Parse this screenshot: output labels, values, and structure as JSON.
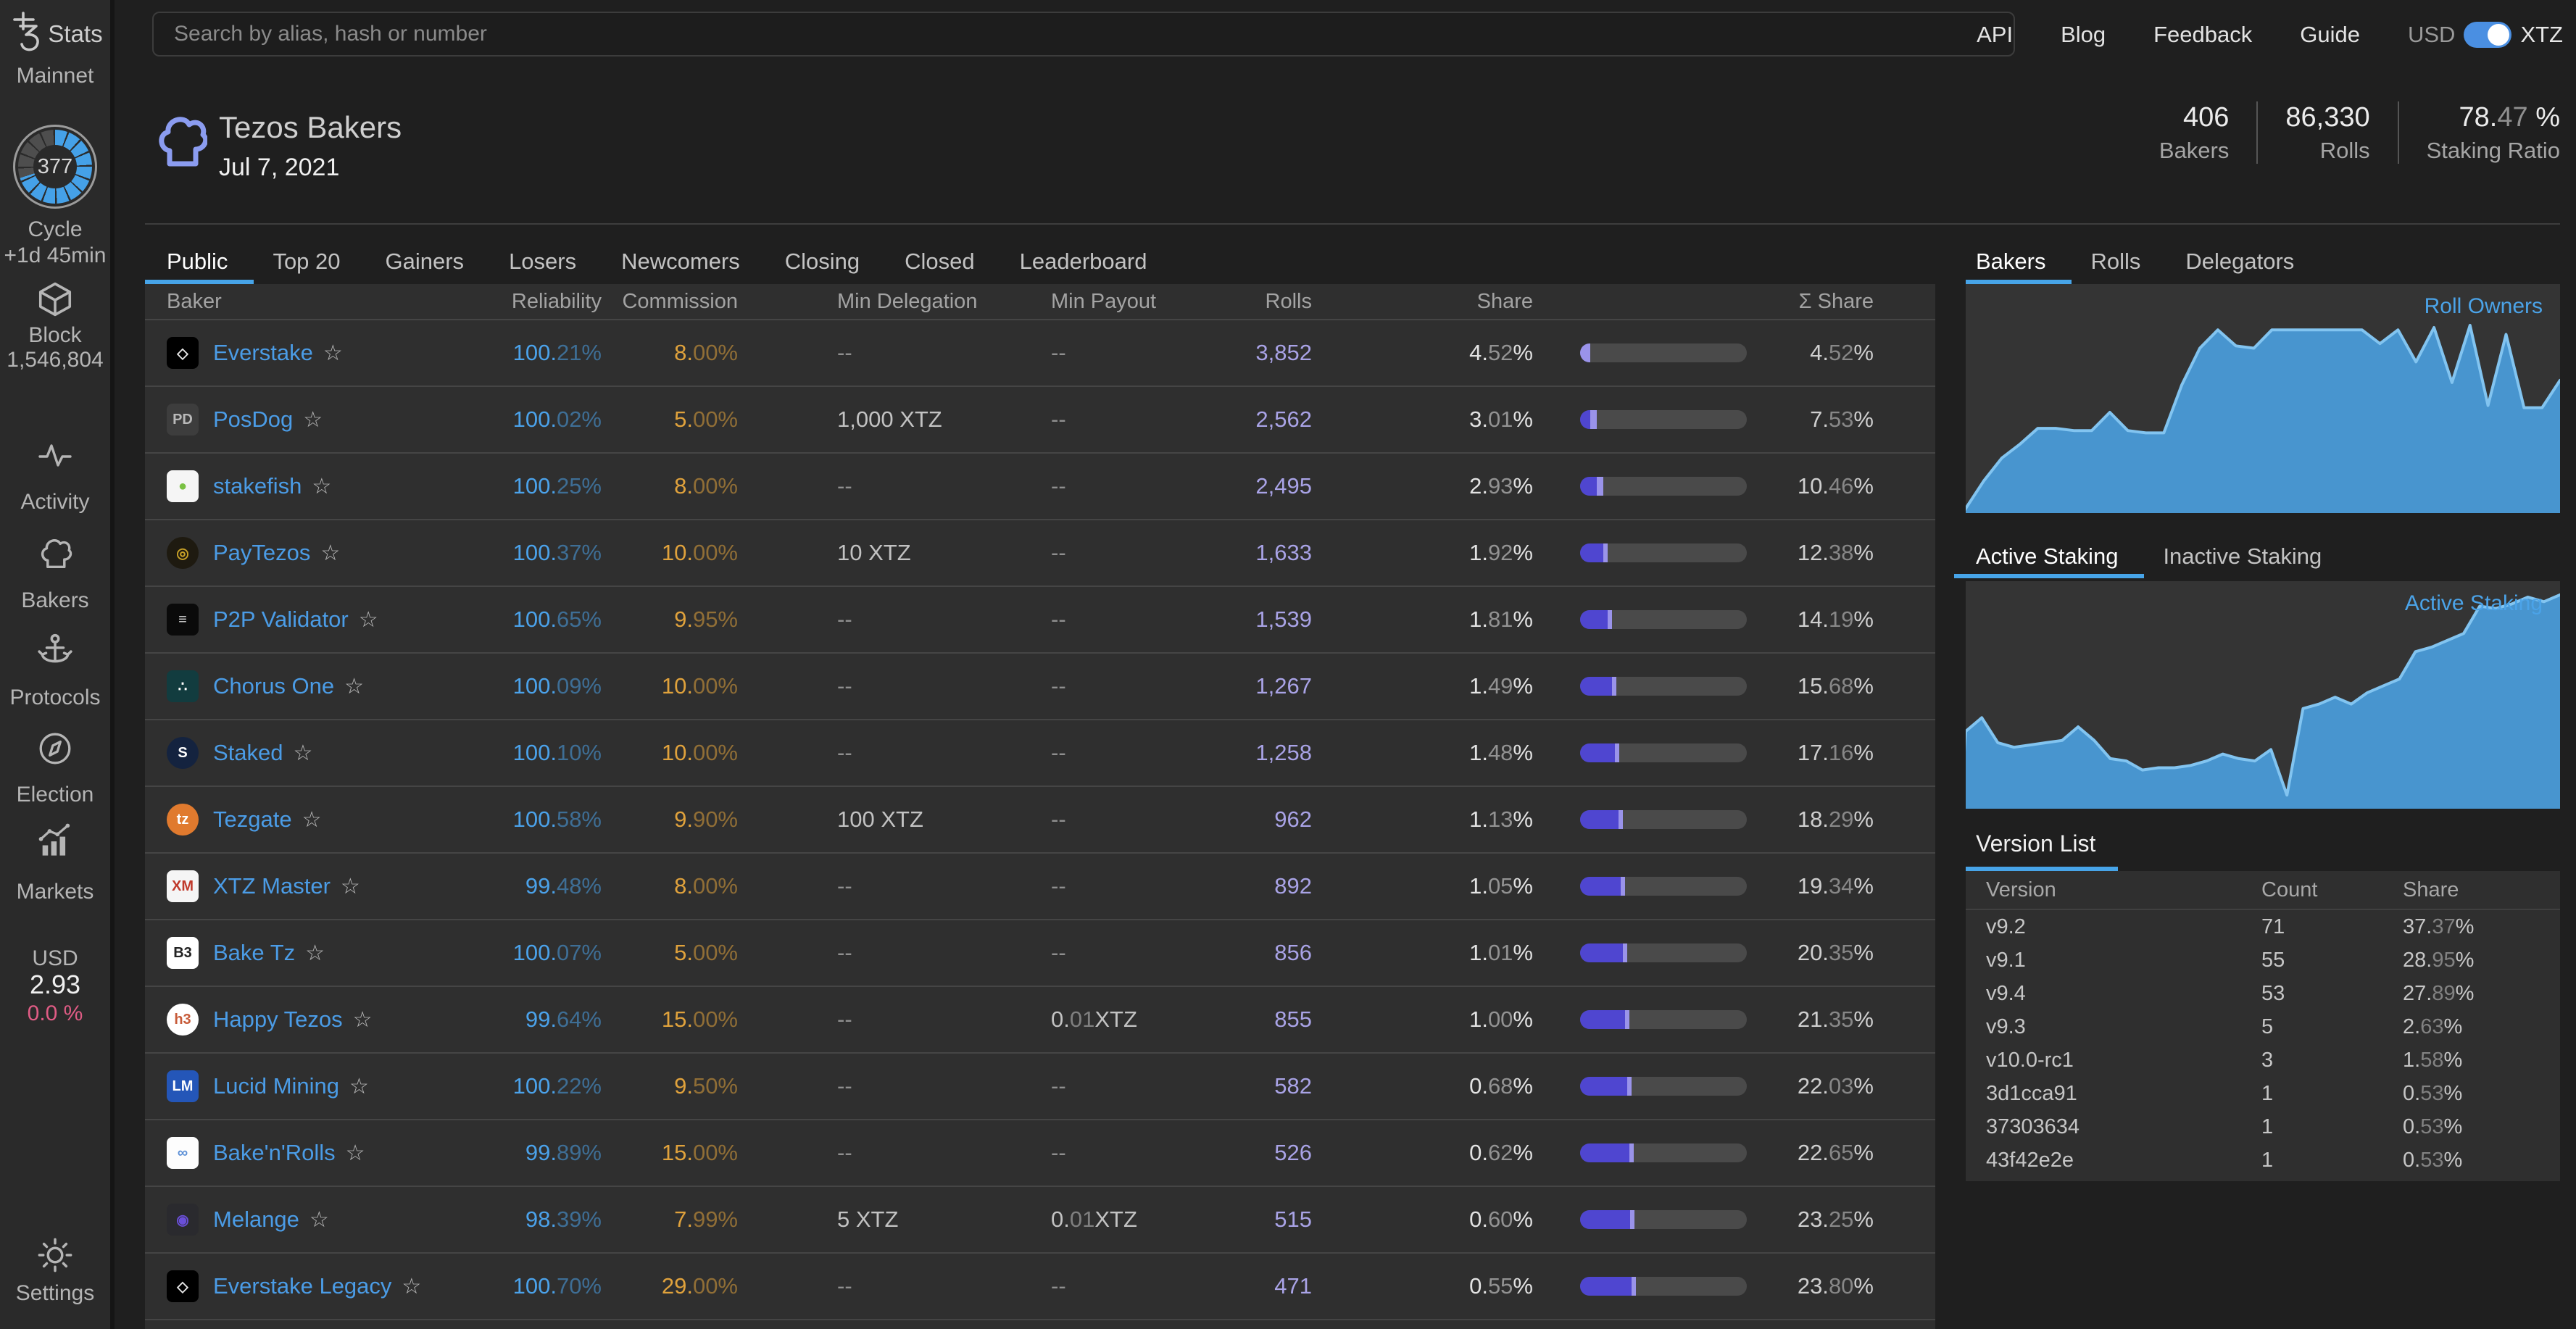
{
  "topbar": {
    "search_placeholder": "Search by alias, hash or number",
    "links": [
      "API",
      "Blog",
      "Feedback",
      "Guide"
    ],
    "currency_left": "USD",
    "currency_right": "XTZ"
  },
  "sidebar": {
    "logo_text": "Stats",
    "network": "Mainnet",
    "cycle": {
      "number": "377",
      "label": "Cycle",
      "eta": "+1d 45min",
      "progress_pct": 70
    },
    "block": {
      "label": "Block",
      "value": "1,546,804"
    },
    "items": [
      {
        "label": "Activity",
        "icon": "activity-icon"
      },
      {
        "label": "Bakers",
        "icon": "bakers-icon"
      },
      {
        "label": "Protocols",
        "icon": "protocols-icon"
      },
      {
        "label": "Election",
        "icon": "election-icon"
      },
      {
        "label": "Markets",
        "icon": "markets-icon"
      }
    ],
    "price": {
      "currency": "USD",
      "value": "2.93",
      "change": "0.0 %"
    },
    "settings_label": "Settings"
  },
  "header": {
    "title": "Tezos Bakers",
    "date": "Jul 7, 2021",
    "stats": [
      {
        "value": "406",
        "label": "Bakers"
      },
      {
        "value": "86,330",
        "label": "Rolls"
      },
      {
        "value": "78.47 %",
        "label": "Staking Ratio"
      }
    ]
  },
  "tabs": [
    "Public",
    "Top 20",
    "Gainers",
    "Losers",
    "Newcomers",
    "Closing",
    "Closed",
    "Leaderboard"
  ],
  "active_tab": "Public",
  "table": {
    "columns": [
      "Baker",
      "Reliability",
      "Commission",
      "Min Delegation",
      "Min Payout",
      "Rolls",
      "Share",
      "Σ Share"
    ],
    "bar_scale_max_pct": 75,
    "rows": [
      {
        "name": "Everstake",
        "avatar": {
          "bg": "#000000",
          "fg": "#e8e8e8",
          "glyph": "◇",
          "shape": "square"
        },
        "reliability": "100.21%",
        "commission": "8.00%",
        "min_delegation": "--",
        "min_payout": "--",
        "rolls": "3,852",
        "share": "4.52 %",
        "sum_share": "4.52 %",
        "share_pct": 4.52,
        "cum_before_pct": 0
      },
      {
        "name": "PosDog",
        "avatar": {
          "bg": "#3d3d3d",
          "fg": "#b9b9b9",
          "glyph": "PD",
          "shape": "square"
        },
        "reliability": "100.02%",
        "commission": "5.00%",
        "min_delegation": "1,000 XTZ",
        "min_payout": "--",
        "rolls": "2,562",
        "share": "3.01 %",
        "sum_share": "7.53 %",
        "share_pct": 3.01,
        "cum_before_pct": 4.52
      },
      {
        "name": "stakefish",
        "avatar": {
          "bg": "#f5f5f5",
          "fg": "#7ac143",
          "glyph": "●",
          "shape": "square"
        },
        "reliability": "100.25%",
        "commission": "8.00%",
        "min_delegation": "--",
        "min_payout": "--",
        "rolls": "2,495",
        "share": "2.93 %",
        "sum_share": "10.46 %",
        "share_pct": 2.93,
        "cum_before_pct": 7.53
      },
      {
        "name": "PayTezos",
        "avatar": {
          "bg": "#1e1a10",
          "fg": "#c9a227",
          "glyph": "◎",
          "shape": "circle"
        },
        "reliability": "100.37%",
        "commission": "10.00%",
        "min_delegation": "10 XTZ",
        "min_payout": "--",
        "rolls": "1,633",
        "share": "1.92 %",
        "sum_share": "12.38 %",
        "share_pct": 1.92,
        "cum_before_pct": 10.46
      },
      {
        "name": "P2P Validator",
        "avatar": {
          "bg": "#0a0a0a",
          "fg": "#dddddd",
          "glyph": "≡",
          "shape": "square"
        },
        "reliability": "100.65%",
        "commission": "9.95%",
        "min_delegation": "--",
        "min_payout": "--",
        "rolls": "1,539",
        "share": "1.81 %",
        "sum_share": "14.19 %",
        "share_pct": 1.81,
        "cum_before_pct": 12.38
      },
      {
        "name": "Chorus One",
        "avatar": {
          "bg": "#123c3f",
          "fg": "#ffffff",
          "glyph": "∴",
          "shape": "square"
        },
        "reliability": "100.09%",
        "commission": "10.00%",
        "min_delegation": "--",
        "min_payout": "--",
        "rolls": "1,267",
        "share": "1.49 %",
        "sum_share": "15.68 %",
        "share_pct": 1.49,
        "cum_before_pct": 14.19
      },
      {
        "name": "Staked",
        "avatar": {
          "bg": "#14233f",
          "fg": "#ffffff",
          "glyph": "S",
          "shape": "circle"
        },
        "reliability": "100.10%",
        "commission": "10.00%",
        "min_delegation": "--",
        "min_payout": "--",
        "rolls": "1,258",
        "share": "1.48 %",
        "sum_share": "17.16 %",
        "share_pct": 1.48,
        "cum_before_pct": 15.68
      },
      {
        "name": "Tezgate",
        "avatar": {
          "bg": "#e07a2e",
          "fg": "#ffffff",
          "glyph": "tz",
          "shape": "circle"
        },
        "reliability": "100.58%",
        "commission": "9.90%",
        "min_delegation": "100 XTZ",
        "min_payout": "--",
        "rolls": "962",
        "share": "1.13 %",
        "sum_share": "18.29 %",
        "share_pct": 1.13,
        "cum_before_pct": 17.16
      },
      {
        "name": "XTZ Master",
        "avatar": {
          "bg": "#f5f5f5",
          "fg": "#c0392b",
          "glyph": "XM",
          "shape": "square"
        },
        "reliability": "99.48%",
        "commission": "8.00%",
        "min_delegation": "--",
        "min_payout": "--",
        "rolls": "892",
        "share": "1.05 %",
        "sum_share": "19.34 %",
        "share_pct": 1.05,
        "cum_before_pct": 18.29
      },
      {
        "name": "Bake Tz",
        "avatar": {
          "bg": "#ffffff",
          "fg": "#222222",
          "glyph": "B3",
          "shape": "square"
        },
        "reliability": "100.07%",
        "commission": "5.00%",
        "min_delegation": "--",
        "min_payout": "--",
        "rolls": "856",
        "share": "1.01 %",
        "sum_share": "20.35 %",
        "share_pct": 1.01,
        "cum_before_pct": 19.34
      },
      {
        "name": "Happy Tezos",
        "avatar": {
          "bg": "#ffffff",
          "fg": "#c75b39",
          "glyph": "h3",
          "shape": "circle"
        },
        "reliability": "99.64%",
        "commission": "15.00%",
        "min_delegation": "--",
        "min_payout": "0.01 XTZ",
        "rolls": "855",
        "share": "1.00 %",
        "sum_share": "21.35 %",
        "share_pct": 1.0,
        "cum_before_pct": 20.35
      },
      {
        "name": "Lucid Mining",
        "avatar": {
          "bg": "#2456b8",
          "fg": "#ffffff",
          "glyph": "LM",
          "shape": "square"
        },
        "reliability": "100.22%",
        "commission": "9.50%",
        "min_delegation": "--",
        "min_payout": "--",
        "rolls": "582",
        "share": "0.68 %",
        "sum_share": "22.03 %",
        "share_pct": 0.68,
        "cum_before_pct": 21.35
      },
      {
        "name": "Bake'n'Rolls",
        "avatar": {
          "bg": "#fdfdfd",
          "fg": "#5b8fd6",
          "glyph": "∞",
          "shape": "square"
        },
        "reliability": "99.89%",
        "commission": "15.00%",
        "min_delegation": "--",
        "min_payout": "--",
        "rolls": "526",
        "share": "0.62 %",
        "sum_share": "22.65 %",
        "share_pct": 0.62,
        "cum_before_pct": 22.03
      },
      {
        "name": "Melange",
        "avatar": {
          "bg": "#2a2a2e",
          "fg": "#6a4fd8",
          "glyph": "◉",
          "shape": "square"
        },
        "reliability": "98.39%",
        "commission": "7.99%",
        "min_delegation": "5 XTZ",
        "min_payout": "0.01 XTZ",
        "rolls": "515",
        "share": "0.60 %",
        "sum_share": "23.25 %",
        "share_pct": 0.6,
        "cum_before_pct": 22.65
      },
      {
        "name": "Everstake Legacy",
        "avatar": {
          "bg": "#000000",
          "fg": "#e8e8e8",
          "glyph": "◇",
          "shape": "square"
        },
        "reliability": "100.70%",
        "commission": "29.00%",
        "min_delegation": "--",
        "min_payout": "--",
        "rolls": "471",
        "share": "0.55 %",
        "sum_share": "23.80 %",
        "share_pct": 0.55,
        "cum_before_pct": 23.25
      }
    ]
  },
  "right_panel": {
    "tabs1": [
      "Bakers",
      "Rolls",
      "Delegators"
    ],
    "active_tab1": "Bakers",
    "chart1_label": "Roll Owners",
    "tabs2": [
      "Active Staking",
      "Inactive Staking"
    ],
    "active_tab2": "Active Staking",
    "chart2_label": "Active Staking",
    "version_list": {
      "title": "Version List",
      "columns": [
        "Version",
        "Count",
        "Share"
      ],
      "rows": [
        [
          "v9.2",
          "71",
          "37.37 %"
        ],
        [
          "v9.1",
          "55",
          "28.95 %"
        ],
        [
          "v9.4",
          "53",
          "27.89 %"
        ],
        [
          "v9.3",
          "5",
          "2.63 %"
        ],
        [
          "v10.0-rc1",
          "3",
          "1.58 %"
        ],
        [
          "3d1cca91",
          "1",
          "0.53 %"
        ],
        [
          "37303634",
          "1",
          "0.53 %"
        ],
        [
          "43f42e2e",
          "1",
          "0.53 %"
        ]
      ]
    }
  },
  "chart_data": [
    {
      "type": "area",
      "title": "Roll Owners",
      "legend_position": "top-right",
      "grid": false,
      "axes_shown": false,
      "unit": "percent of chart height (no axis labels shown)",
      "fill_color": "#4895cf",
      "stroke_color": "#82c4f0",
      "series": [
        {
          "name": "Roll Owners",
          "values": [
            2,
            14,
            24,
            30,
            37,
            37,
            36,
            36,
            44,
            36,
            35,
            35,
            56,
            72,
            80,
            73,
            72,
            80,
            80,
            80,
            80,
            80,
            80,
            74,
            80,
            66,
            81,
            57,
            82,
            47,
            78,
            46,
            46,
            58
          ]
        }
      ]
    },
    {
      "type": "area",
      "title": "Active Staking",
      "legend_position": "top-right",
      "grid": false,
      "axes_shown": false,
      "unit": "percent of chart height (no axis labels shown)",
      "fill_color": "#4895cf",
      "stroke_color": "#82c4f0",
      "series": [
        {
          "name": "Active Staking",
          "values": [
            34,
            40,
            29,
            27,
            28,
            29,
            30,
            36,
            30,
            22,
            21,
            17,
            18,
            18,
            19,
            21,
            24,
            22,
            21,
            26,
            6,
            44,
            46,
            49,
            46,
            51,
            54,
            57,
            69,
            71,
            74,
            77,
            89,
            88,
            90,
            93,
            91,
            94
          ]
        }
      ]
    }
  ]
}
